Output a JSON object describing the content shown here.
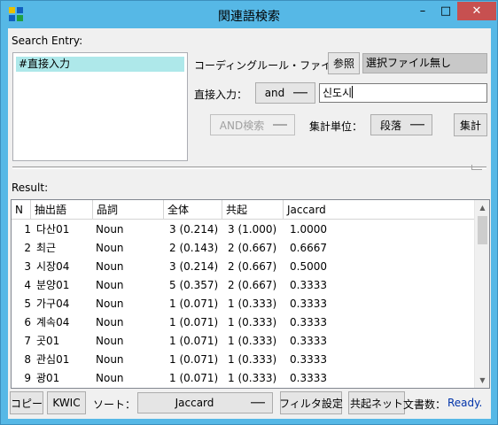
{
  "window": {
    "title": "関連語検索",
    "minimize": "–",
    "maximize": "□",
    "close": "✕"
  },
  "search_entry": {
    "label": "Search Entry:",
    "items": [
      "#直接入力"
    ]
  },
  "coding_rule": {
    "label": "コーディングルール・ファイル：",
    "browse": "参照",
    "file_value": "選択ファイル無し"
  },
  "direct_input": {
    "label": "直接入力：",
    "mode": "and",
    "value": "신도시"
  },
  "search_controls": {
    "and_search": "AND検索",
    "unit_label": "集計単位：",
    "unit_value": "段落",
    "count_button": "集計"
  },
  "result": {
    "label": "Result:",
    "columns": [
      "N",
      "抽出語",
      "品詞",
      "全体",
      "共起",
      "Jaccard"
    ],
    "rows": [
      {
        "n": "1",
        "word": "다산01",
        "pos": "Noun",
        "total": "3 (0.214)",
        "cooc": "3 (1.000)",
        "jaccard": "1.0000"
      },
      {
        "n": "2",
        "word": "최근",
        "pos": "Noun",
        "total": "2 (0.143)",
        "cooc": "2 (0.667)",
        "jaccard": "0.6667"
      },
      {
        "n": "3",
        "word": "시장04",
        "pos": "Noun",
        "total": "3 (0.214)",
        "cooc": "2 (0.667)",
        "jaccard": "0.5000"
      },
      {
        "n": "4",
        "word": "분양01",
        "pos": "Noun",
        "total": "5 (0.357)",
        "cooc": "2 (0.667)",
        "jaccard": "0.3333"
      },
      {
        "n": "5",
        "word": "가구04",
        "pos": "Noun",
        "total": "1 (0.071)",
        "cooc": "1 (0.333)",
        "jaccard": "0.3333"
      },
      {
        "n": "6",
        "word": "계속04",
        "pos": "Noun",
        "total": "1 (0.071)",
        "cooc": "1 (0.333)",
        "jaccard": "0.3333"
      },
      {
        "n": "7",
        "word": "곳01",
        "pos": "Noun",
        "total": "1 (0.071)",
        "cooc": "1 (0.333)",
        "jaccard": "0.3333"
      },
      {
        "n": "8",
        "word": "관심01",
        "pos": "Noun",
        "total": "1 (0.071)",
        "cooc": "1 (0.333)",
        "jaccard": "0.3333"
      },
      {
        "n": "9",
        "word": "광01",
        "pos": "Noun",
        "total": "1 (0.071)",
        "cooc": "1 (0.333)",
        "jaccard": "0.3333"
      }
    ]
  },
  "bottom_bar": {
    "copy": "コピー",
    "kwic": "KWIC",
    "sort_label": "ソート：",
    "sort_value": "Jaccard",
    "filter": "フィルタ設定",
    "cooc_net": "共起ネット",
    "doc_count_label": "文書数：",
    "status": "Ready."
  },
  "colors": {
    "title_bar": "#56b8e6",
    "close_button": "#c75050",
    "selection": "#aee8ea",
    "status_text": "#0033aa"
  }
}
